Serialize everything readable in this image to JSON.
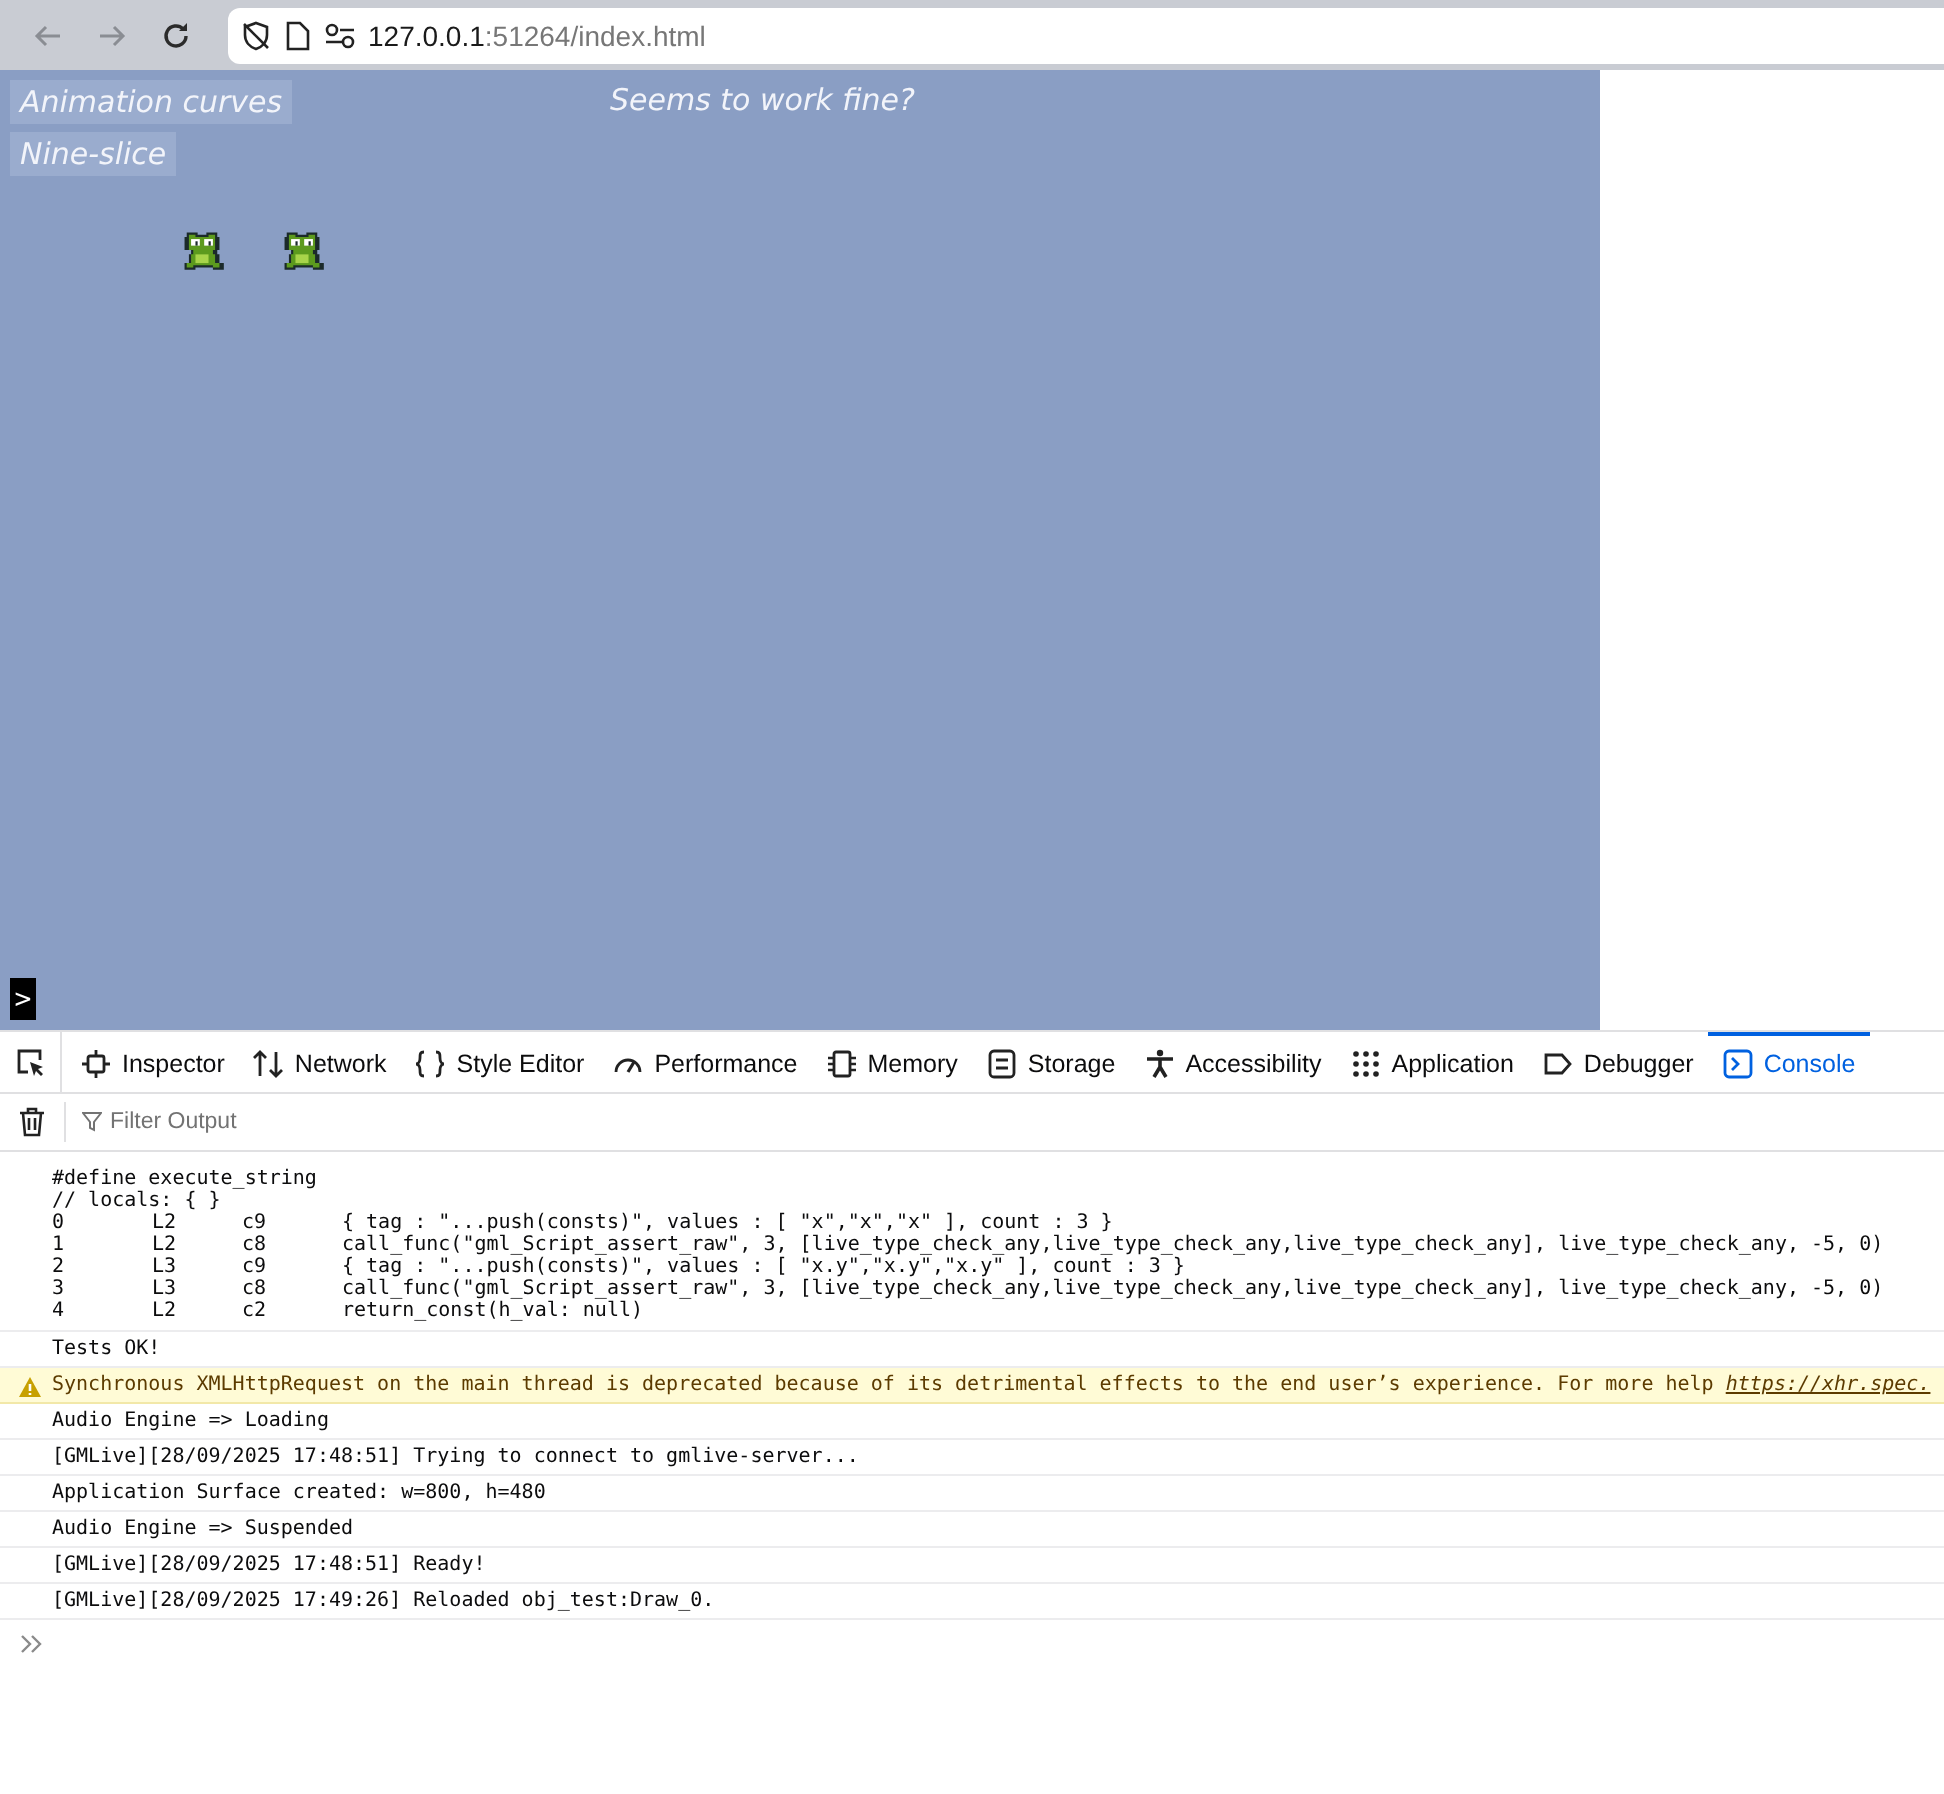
{
  "browser": {
    "back_disabled": true,
    "forward_disabled": true,
    "url_host": "127.0.0.1",
    "url_rest": ":51264/index.html"
  },
  "game": {
    "buttons": [
      "Animation curves",
      "Nine-slice"
    ],
    "message": "Seems to work fine?",
    "sprites": [
      {
        "kind": "frog"
      },
      {
        "kind": "frog"
      }
    ],
    "prompt": ">"
  },
  "devtools": {
    "tabs": [
      {
        "label": "Inspector",
        "selected": false
      },
      {
        "label": "Network",
        "selected": false
      },
      {
        "label": "Style Editor",
        "selected": false
      },
      {
        "label": "Performance",
        "selected": false
      },
      {
        "label": "Memory",
        "selected": false
      },
      {
        "label": "Storage",
        "selected": false
      },
      {
        "label": "Accessibility",
        "selected": false
      },
      {
        "label": "Application",
        "selected": false
      },
      {
        "label": "Debugger",
        "selected": false
      },
      {
        "label": "Console",
        "selected": true
      }
    ],
    "filter": {
      "placeholder": "Filter Output"
    },
    "messages": [
      {
        "kind": "block",
        "lines": [
          "#define execute_string",
          "// locals: { }"
        ],
        "rows": [
          [
            "0",
            "L2",
            "c9",
            "{ tag : \"...push(consts)\", values : [ \"x\",\"x\",\"x\" ], count : 3 }"
          ],
          [
            "1",
            "L2",
            "c8",
            "call_func(\"gml_Script_assert_raw\", 3, [live_type_check_any,live_type_check_any,live_type_check_any], live_type_check_any, -5, 0)"
          ],
          [
            "2",
            "L3",
            "c9",
            "{ tag : \"...push(consts)\", values : [ \"x.y\",\"x.y\",\"x.y\" ], count : 3 }"
          ],
          [
            "3",
            "L3",
            "c8",
            "call_func(\"gml_Script_assert_raw\", 3, [live_type_check_any,live_type_check_any,live_type_check_any], live_type_check_any, -5, 0)"
          ],
          [
            "4",
            "L2",
            "c2",
            "return_const(h_val: null)"
          ]
        ]
      },
      {
        "kind": "log",
        "text": "Tests OK!"
      },
      {
        "kind": "warning",
        "text": "Synchronous XMLHttpRequest on the main thread is deprecated because of its detrimental effects to the end user’s experience. For more help",
        "link": "https://xhr.spec."
      },
      {
        "kind": "log",
        "text": "Audio Engine => Loading"
      },
      {
        "kind": "log",
        "text": "[GMLive][28/09/2025 17:48:51] Trying to connect to gmlive-server..."
      },
      {
        "kind": "log",
        "text": "Application Surface created: w=800, h=480"
      },
      {
        "kind": "log",
        "text": "Audio Engine => Suspended"
      },
      {
        "kind": "log",
        "text": "[GMLive][28/09/2025 17:48:51] Ready!"
      },
      {
        "kind": "log",
        "text": "[GMLive][28/09/2025 17:49:26] Reloaded obj_test:Draw_0."
      }
    ]
  }
}
